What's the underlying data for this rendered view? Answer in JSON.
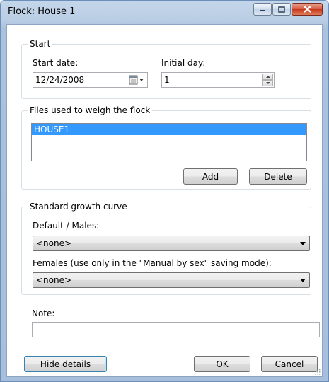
{
  "window": {
    "title": "Flock: House 1",
    "minimize_icon": "minimize-icon",
    "maximize_icon": "maximize-icon",
    "close_icon": "close-icon"
  },
  "start": {
    "group_label": "Start",
    "start_date_label": "Start date:",
    "start_date_value": "12/24/2008",
    "calendar_icon": "calendar-dropdown-icon",
    "initial_day_label": "Initial day:",
    "initial_day_value": "1"
  },
  "files": {
    "group_label": "Files used to weigh the flock",
    "items": [
      "HOUSE1"
    ],
    "add_label": "Add",
    "delete_label": "Delete"
  },
  "growth": {
    "group_label": "Standard growth curve",
    "default_label": "Default / Males:",
    "default_value": "<none>",
    "females_label": "Females (use only in the \"Manual by sex\" saving mode):",
    "females_value": "<none>"
  },
  "note": {
    "label": "Note:",
    "value": ""
  },
  "footer": {
    "hide_details_label": "Hide details",
    "ok_label": "OK",
    "cancel_label": "Cancel"
  }
}
